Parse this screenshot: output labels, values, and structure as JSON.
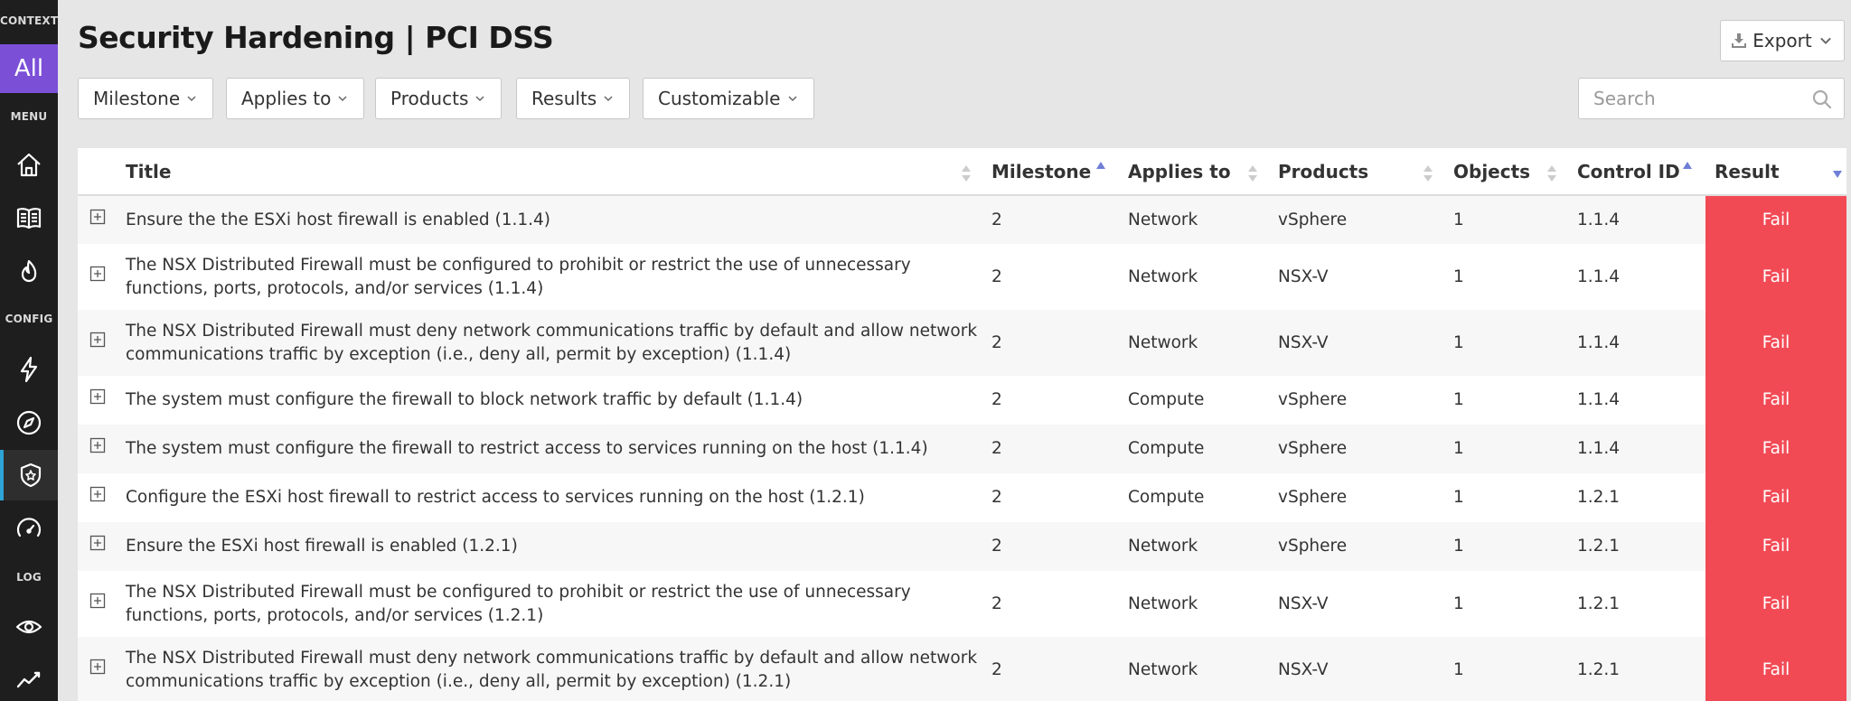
{
  "sidebar": {
    "context_label": "CONTEXT",
    "all_label": "All",
    "menu_label": "MENU",
    "config_label": "CONFIG",
    "log_label": "LOG",
    "icons": [
      "home-icon",
      "book-icon",
      "flame-icon",
      "lightning-icon",
      "compass-icon",
      "shield-icon",
      "speedometer-icon",
      "eye-icon",
      "trend-icon"
    ]
  },
  "header": {
    "title": "Security Hardening | PCI DSS",
    "export_label": "Export"
  },
  "filters": [
    "Milestone",
    "Applies to",
    "Products",
    "Results",
    "Customizable"
  ],
  "search": {
    "placeholder": "Search"
  },
  "table": {
    "columns": [
      "Title",
      "Milestone",
      "Applies to",
      "Products",
      "Objects",
      "Control ID",
      "Result"
    ],
    "rows": [
      {
        "title": "Ensure the the ESXi host firewall is enabled (1.1.4)",
        "milestone": "2",
        "applies_to": "Network",
        "products": "vSphere",
        "objects": "1",
        "control_id": "1.1.4",
        "result": "Fail"
      },
      {
        "title": "The NSX Distributed Firewall must be configured to prohibit or restrict the use of unnecessary functions, ports, protocols, and/or services (1.1.4)",
        "milestone": "2",
        "applies_to": "Network",
        "products": "NSX-V",
        "objects": "1",
        "control_id": "1.1.4",
        "result": "Fail"
      },
      {
        "title": "The NSX Distributed Firewall must deny network communications traffic by default and allow network communications traffic by exception (i.e., deny all, permit by exception) (1.1.4)",
        "milestone": "2",
        "applies_to": "Network",
        "products": "NSX-V",
        "objects": "1",
        "control_id": "1.1.4",
        "result": "Fail"
      },
      {
        "title": "The system must configure the firewall to block network traffic by default (1.1.4)",
        "milestone": "2",
        "applies_to": "Compute",
        "products": "vSphere",
        "objects": "1",
        "control_id": "1.1.4",
        "result": "Fail"
      },
      {
        "title": "The system must configure the firewall to restrict access to services running on the host (1.1.4)",
        "milestone": "2",
        "applies_to": "Compute",
        "products": "vSphere",
        "objects": "1",
        "control_id": "1.1.4",
        "result": "Fail"
      },
      {
        "title": "Configure the ESXi host firewall to restrict access to services running on the host (1.2.1)",
        "milestone": "2",
        "applies_to": "Compute",
        "products": "vSphere",
        "objects": "1",
        "control_id": "1.2.1",
        "result": "Fail"
      },
      {
        "title": "Ensure the ESXi host firewall is enabled (1.2.1)",
        "milestone": "2",
        "applies_to": "Network",
        "products": "vSphere",
        "objects": "1",
        "control_id": "1.2.1",
        "result": "Fail"
      },
      {
        "title": "The NSX Distributed Firewall must be configured to prohibit or restrict the use of unnecessary functions, ports, protocols, and/or services (1.2.1)",
        "milestone": "2",
        "applies_to": "Network",
        "products": "NSX-V",
        "objects": "1",
        "control_id": "1.2.1",
        "result": "Fail"
      },
      {
        "title": "The NSX Distributed Firewall must deny network communications traffic by default and allow network communications traffic by exception (i.e., deny all, permit by exception) (1.2.1)",
        "milestone": "2",
        "applies_to": "Network",
        "products": "NSX-V",
        "objects": "1",
        "control_id": "1.2.1",
        "result": "Fail"
      }
    ]
  },
  "colors": {
    "accent": "#7b4fd6",
    "fail": "#f24a55",
    "sidebar_bg": "#1e1e1e",
    "active_indicator": "#2ea3d6",
    "sort_arrow": "#6f7fd6"
  }
}
